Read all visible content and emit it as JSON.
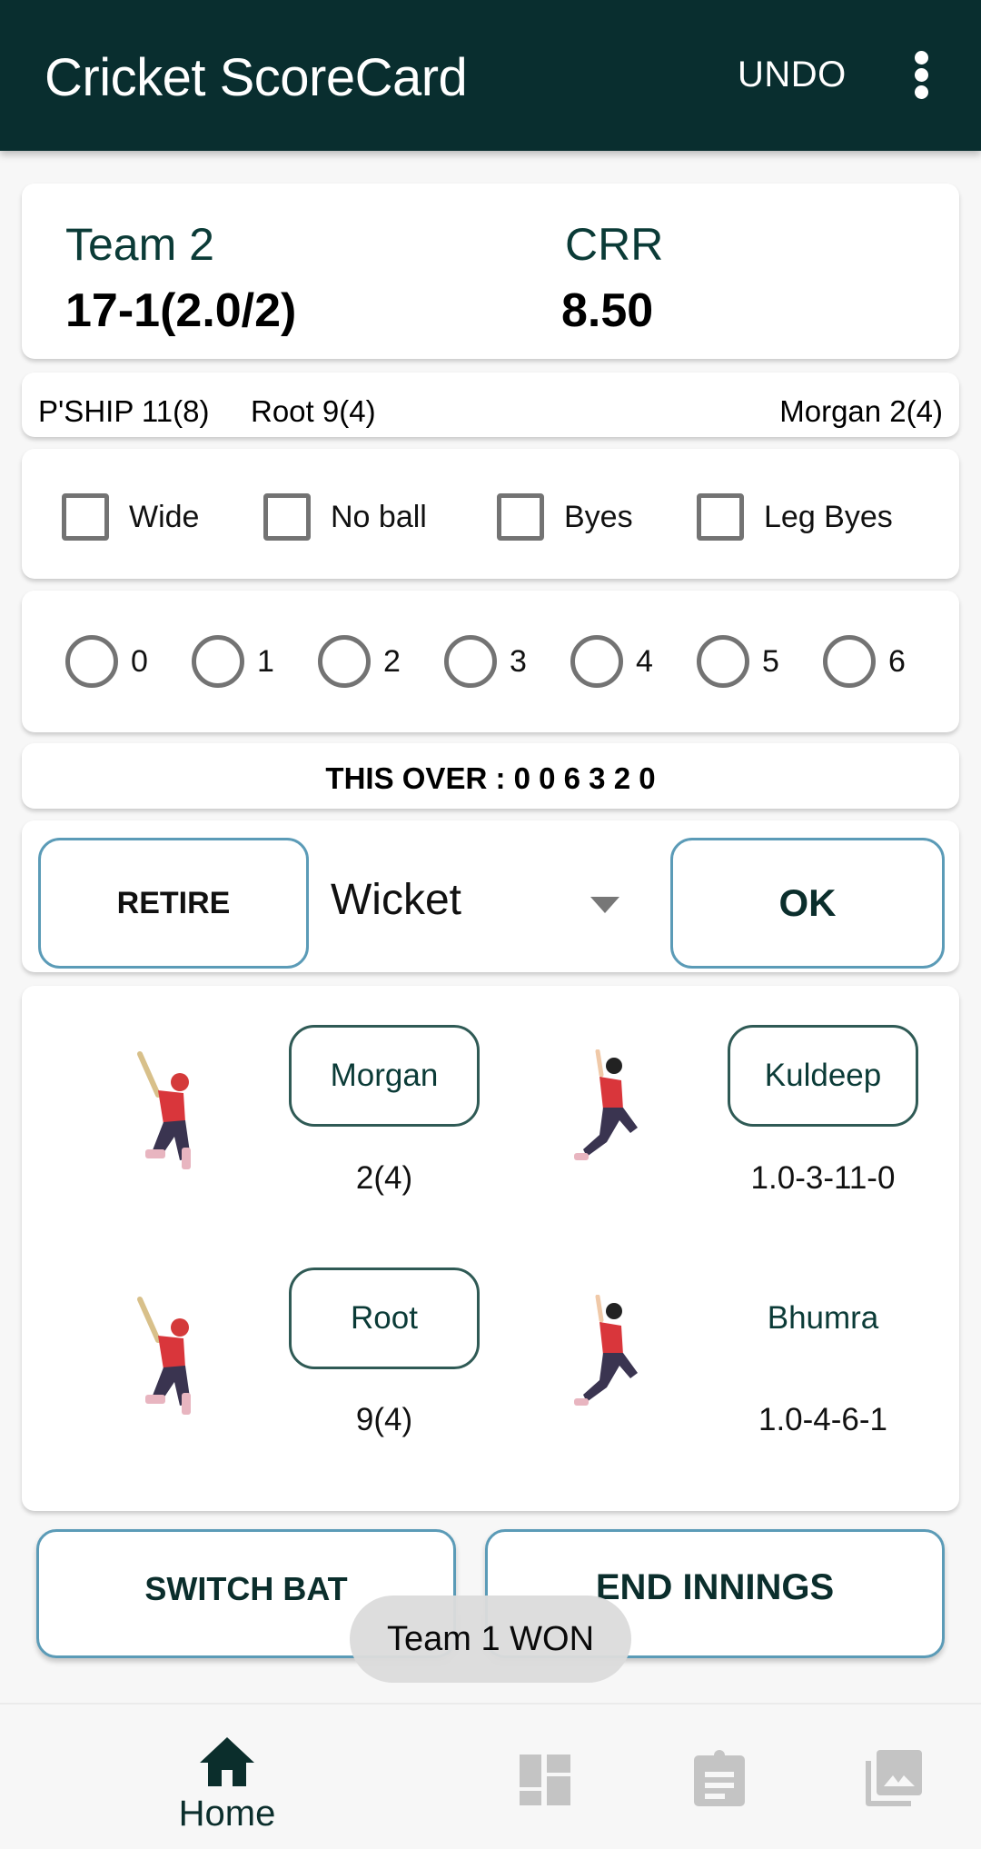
{
  "appbar": {
    "title": "Cricket ScoreCard",
    "undo_label": "UNDO",
    "more_icon": "more-vert-icon"
  },
  "score": {
    "team_label": "Team 2",
    "score_text": "17-1(2.0/2)",
    "crr_label": "CRR",
    "crr_value": "8.50"
  },
  "partnership": {
    "pship_text": "P'SHIP 11(8)",
    "batter1_text": "Root 9(4)",
    "batter2_text": "Morgan 2(4)"
  },
  "extras": [
    {
      "label": "Wide",
      "checked": false
    },
    {
      "label": "No ball",
      "checked": false
    },
    {
      "label": "Byes",
      "checked": false
    },
    {
      "label": "Leg Byes",
      "checked": false
    }
  ],
  "runs": [
    {
      "label": "0",
      "selected": false
    },
    {
      "label": "1",
      "selected": false
    },
    {
      "label": "2",
      "selected": false
    },
    {
      "label": "3",
      "selected": false
    },
    {
      "label": "4",
      "selected": false
    },
    {
      "label": "5",
      "selected": false
    },
    {
      "label": "6",
      "selected": false
    }
  ],
  "this_over": "THIS OVER : 0 0 6 3 2 0",
  "actions": {
    "retire_label": "RETIRE",
    "wicket_selected": "Wicket",
    "ok_label": "OK"
  },
  "players": {
    "batters": [
      {
        "name": "Morgan",
        "stats": "2(4)"
      },
      {
        "name": "Root",
        "stats": "9(4)"
      }
    ],
    "bowlers": [
      {
        "name": "Kuldeep",
        "stats": "1.0-3-11-0"
      },
      {
        "name": "Bhumra",
        "stats": "1.0-4-6-1"
      }
    ]
  },
  "buttons": {
    "switch_bat": "SWITCH BAT",
    "end_innings": "END INNINGS"
  },
  "toast": "Team 1 WON",
  "bottom_nav": [
    {
      "label": "Home",
      "icon": "home-icon",
      "active": true
    },
    {
      "label": "",
      "icon": "dashboard-icon",
      "active": false
    },
    {
      "label": "",
      "icon": "clipboard-icon",
      "active": false
    },
    {
      "label": "",
      "icon": "gallery-icon",
      "active": false
    }
  ],
  "colors": {
    "primary": "#092e2f",
    "accent_border": "#5b9bb7",
    "inactive_icon": "#c4c4c4"
  }
}
